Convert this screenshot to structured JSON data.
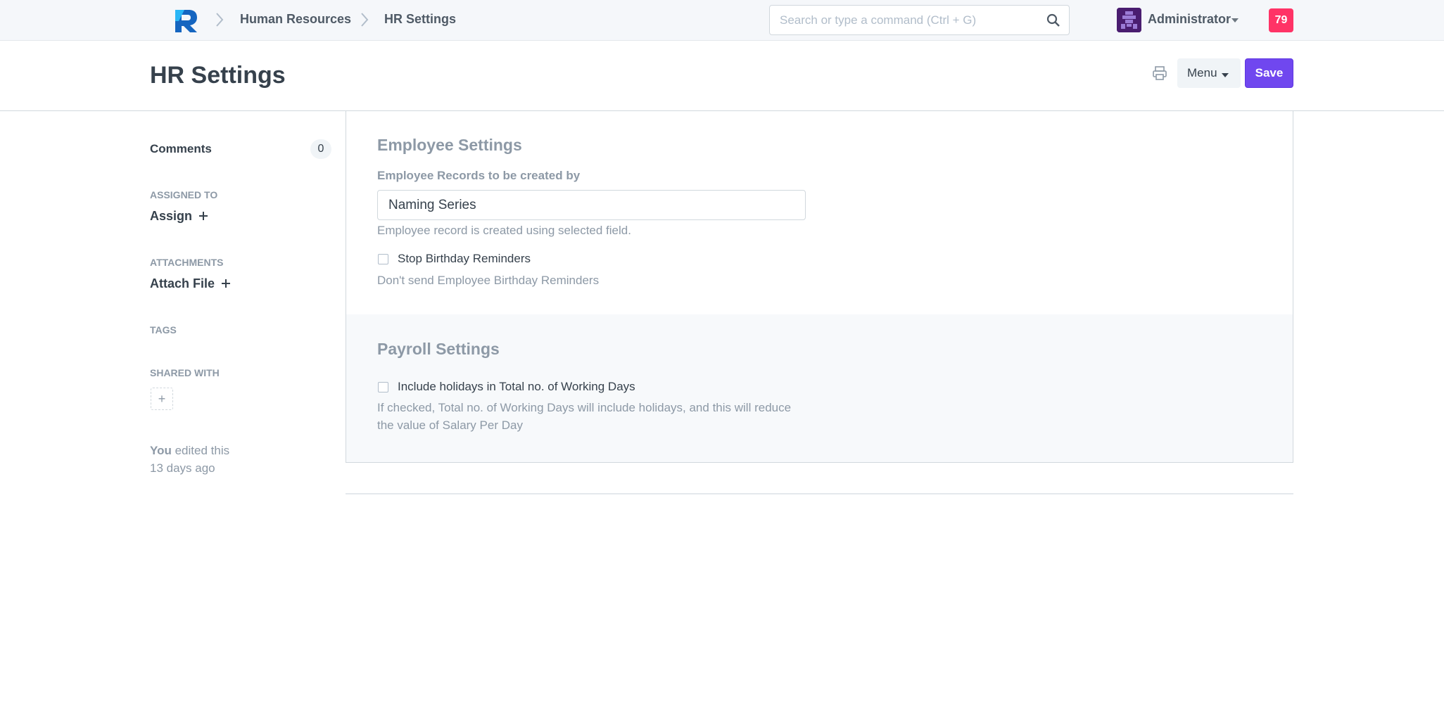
{
  "navbar": {
    "breadcrumbs": [
      "Human Resources",
      "HR Settings"
    ],
    "search_placeholder": "Search or type a command (Ctrl + G)",
    "user_name": "Administrator",
    "notification_count": "79"
  },
  "page": {
    "title": "HR Settings",
    "menu_label": "Menu",
    "save_label": "Save"
  },
  "sidebar": {
    "comments_label": "Comments",
    "comments_count": "0",
    "assigned_to_label": "ASSIGNED TO",
    "assign_action": "Assign",
    "attachments_label": "ATTACHMENTS",
    "attach_action": "Attach File",
    "tags_label": "TAGS",
    "shared_with_label": "SHARED WITH",
    "shared_add": "+",
    "edited_by": "You",
    "edited_text": "edited this",
    "edited_when": "13 days ago"
  },
  "employee_settings": {
    "title": "Employee Settings",
    "records_label": "Employee Records to be created by",
    "records_value": "Naming Series",
    "records_help": "Employee record is created using selected field.",
    "stop_birthday_label": "Stop Birthday Reminders",
    "stop_birthday_checked": false,
    "stop_birthday_help": "Don't send Employee Birthday Reminders"
  },
  "payroll_settings": {
    "title": "Payroll Settings",
    "include_holidays_label": "Include holidays in Total no. of Working Days",
    "include_holidays_checked": false,
    "include_holidays_help_1": "If checked, Total no. of Working Days will include holidays, and this will reduce",
    "include_holidays_help_2": "the value of Salary Per Day"
  },
  "colors": {
    "primary": "#7047ef",
    "notification": "#ff3366",
    "logo_blue": "#1a73e8",
    "muted_text": "#8d99a6"
  },
  "icons": [
    "app-logo-icon",
    "chevron-right-icon",
    "search-icon",
    "avatar-icon",
    "caret-down-icon",
    "print-icon",
    "plus-icon"
  ]
}
